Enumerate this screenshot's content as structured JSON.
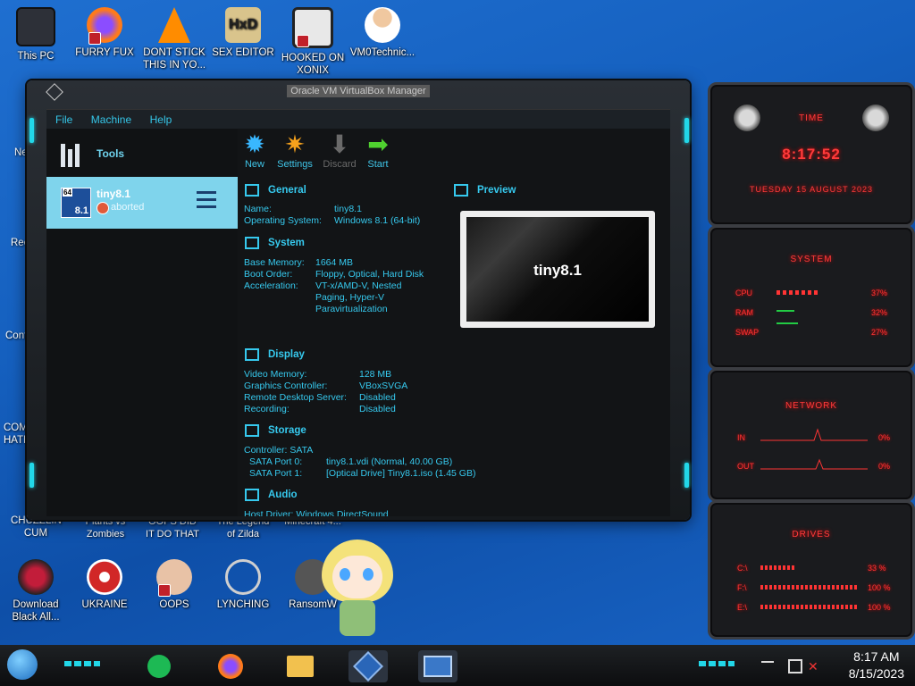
{
  "desktop": {
    "icons_top": [
      {
        "label": "This PC",
        "color": "#3a3f48"
      },
      {
        "label": "FURRY FUX",
        "color": "#ff7a1a"
      },
      {
        "label": "DONT STICK THIS IN YO...",
        "color": "#ff8c00"
      },
      {
        "label": "SEX EDITOR",
        "color": "#d9c48c"
      },
      {
        "label": "HOOKED ON XONIX",
        "color": "#2a2a2a"
      },
      {
        "label": "VM0Technic...",
        "color": "#f0c8a0"
      }
    ],
    "left_cut_labels": [
      "Ne",
      "Recy",
      "Contr",
      "COMM HATE",
      "CHUZZLIN CUM"
    ],
    "icons_row2": [
      "Plants vs Zombies",
      "OOPS DID IT DO THAT",
      "The Legend of Zilda",
      "Minecraft 4..."
    ],
    "icons_bottom": [
      {
        "label": "Download Black All...",
        "color": "#c21d3a"
      },
      {
        "label": "UKRAINE",
        "color": "#d12727"
      },
      {
        "label": "OOPS",
        "color": "#e8c2a6"
      },
      {
        "label": "LYNCHING",
        "color": "#cfcfcf"
      },
      {
        "label": "RansomW",
        "color": "#555"
      }
    ]
  },
  "vbox": {
    "title": "Oracle VM VirtualBox Manager",
    "menu": [
      "File",
      "Machine",
      "Help"
    ],
    "tools_label": "Tools",
    "vm_name": "tiny8.1",
    "vm_state": "aborted",
    "vm_icon_text": "8.1",
    "vm_icon_badge": "64",
    "toolbar": [
      {
        "label": "New",
        "glyph": "✹",
        "color": "#39b7ff"
      },
      {
        "label": "Settings",
        "glyph": "✷",
        "color": "#f6a21c"
      },
      {
        "label": "Discard",
        "glyph": "⬇",
        "color": "#6a6a6a"
      },
      {
        "label": "Start",
        "glyph": "➡",
        "color": "#4fd12f"
      }
    ],
    "sections": {
      "general": {
        "title": "General",
        "rows": [
          [
            "Name:",
            "tiny8.1"
          ],
          [
            "Operating System:",
            "Windows 8.1 (64-bit)"
          ]
        ]
      },
      "system": {
        "title": "System",
        "rows": [
          [
            "Base Memory:",
            "1664 MB"
          ],
          [
            "Boot Order:",
            "Floppy, Optical, Hard Disk"
          ],
          [
            "Acceleration:",
            "VT-x/AMD-V, Nested"
          ],
          [
            "",
            "Paging, Hyper-V"
          ],
          [
            "",
            "Paravirtualization"
          ]
        ]
      },
      "display": {
        "title": "Display",
        "rows": [
          [
            "Video Memory:",
            "128 MB"
          ],
          [
            "Graphics Controller:",
            "VBoxSVGA"
          ],
          [
            "Remote Desktop Server:",
            "Disabled"
          ],
          [
            "Recording:",
            "Disabled"
          ]
        ]
      },
      "storage": {
        "title": "Storage",
        "rows": [
          [
            "Controller: SATA",
            ""
          ],
          [
            "SATA Port 0:",
            "tiny8.1.vdi (Normal, 40.00 GB)"
          ],
          [
            "SATA Port 1:",
            "[Optical Drive] Tiny8.1.iso (1.45 GB)"
          ]
        ]
      },
      "audio": {
        "title": "Audio",
        "partial": "Host Driver: Windows DirectSound"
      },
      "preview": {
        "title": "Preview",
        "vm_text": "tiny8.1"
      }
    }
  },
  "gadgets": {
    "time": {
      "title": "TIME",
      "clock": "8:17:52",
      "date": "TUESDAY 15 AUGUST 2023"
    },
    "system": {
      "title": "SYSTEM",
      "rows": [
        [
          "CPU",
          "37%"
        ],
        [
          "RAM",
          "32%"
        ],
        [
          "SWAP",
          "27%"
        ]
      ]
    },
    "network": {
      "title": "NETWORK",
      "rows": [
        [
          "IN",
          "0%"
        ],
        [
          "OUT",
          "0%"
        ]
      ]
    },
    "drives": {
      "title": "DRIVES",
      "rows": [
        [
          "C:\\",
          "33 %"
        ],
        [
          "F:\\",
          "100 %"
        ],
        [
          "E:\\",
          "100 %"
        ]
      ]
    }
  },
  "taskbar": {
    "apps": [
      {
        "name": "spotify",
        "color": "#1db954"
      },
      {
        "name": "firefox",
        "color": "#ff7a1a"
      },
      {
        "name": "explorer",
        "color": "#f2c14e"
      },
      {
        "name": "virtualbox",
        "color": "#2a66b8"
      },
      {
        "name": "window",
        "color": "#3a78c8"
      }
    ],
    "time": "8:17 AM",
    "date": "8/15/2023"
  },
  "sticker": {
    "colors": {
      "hair": "#f4e27a",
      "dress": "#8fbf78"
    }
  }
}
